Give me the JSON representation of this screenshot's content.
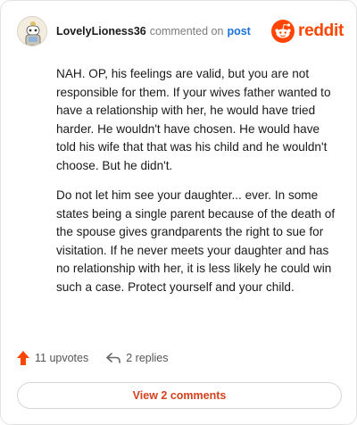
{
  "header": {
    "username": "LovelyLioness36",
    "action_text": "commented on",
    "post_link": "post",
    "brand": "reddit"
  },
  "comment": {
    "paragraphs": [
      "NAH. OP, his feelings are valid, but you are not responsible for them. If your wives father wanted to have a relationship with her, he would have tried harder. He wouldn't have chosen. He would have told his wife that that was his child and he wouldn't choose. But he didn't.",
      "Do not let him see your daughter... ever. In some states being a single parent because of the death of the spouse gives grandparents the right to sue for visitation. If he never meets your daughter and has no relationship with her, it is less likely he could win such a case. Protect yourself and your child."
    ]
  },
  "footer": {
    "upvotes_label": "11 upvotes",
    "replies_label": "2 replies",
    "view_comments_label": "View 2 comments"
  },
  "colors": {
    "brand_orange": "#ff4500",
    "link_blue": "#1a73d9",
    "view_button_text": "#d6411f"
  },
  "icons": {
    "avatar": "snoo-avatar",
    "brand": "reddit-logo-icon",
    "upvote": "upvote-arrow-icon",
    "reply": "reply-arrow-icon"
  }
}
